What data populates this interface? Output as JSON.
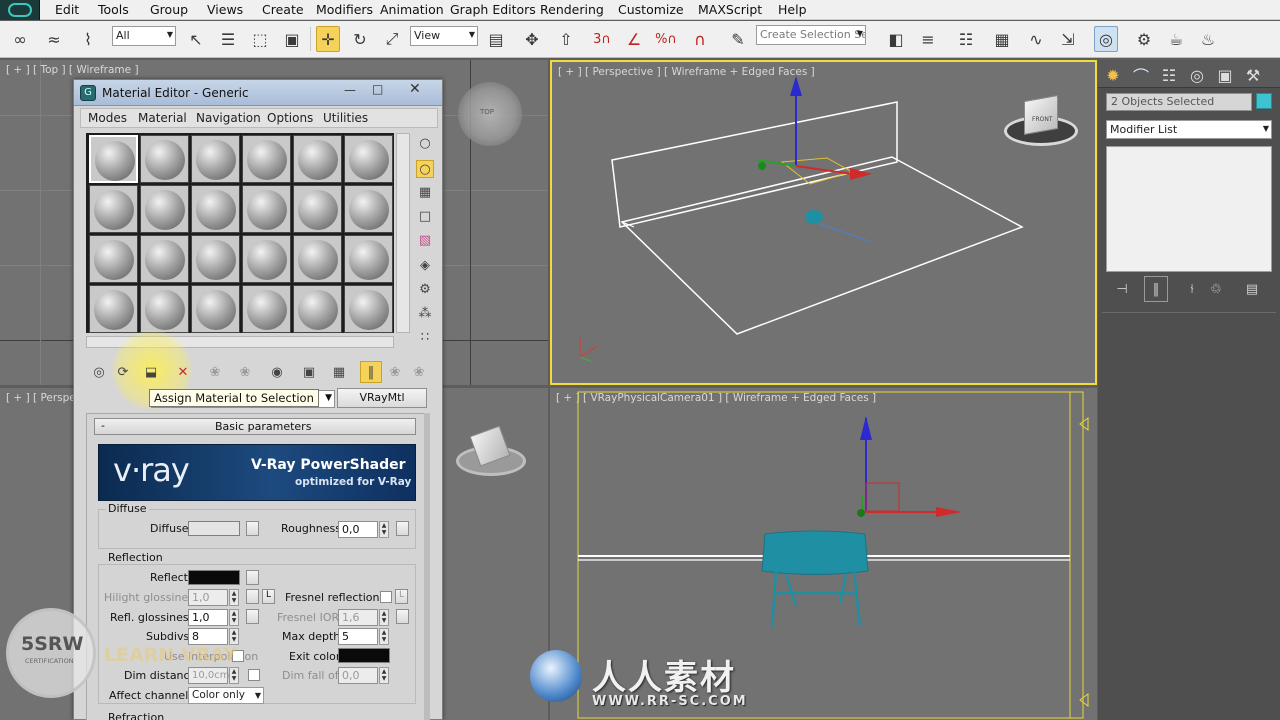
{
  "menu": [
    "Edit",
    "Tools",
    "Group",
    "Views",
    "Create",
    "Modifiers",
    "Animation",
    "Graph Editors",
    "Rendering",
    "Customize",
    "MAXScript",
    "Help"
  ],
  "toolbar": {
    "filter_value": "All",
    "refcoord_value": "View",
    "selection_set_placeholder": "Create Selection Se",
    "snap_labels": [
      "3",
      "%"
    ]
  },
  "viewports": {
    "top_label": "[ + ] [ Top ] [ Wireframe ]",
    "perspective_label": "[ + ] [ Perspective ] [ Wireframe + Edged Faces ]",
    "left_bottom_label": "[ + ] [ Perspec",
    "camera_label": "[ + ] [ VRayPhysicalCamera01 ] [ Wireframe + Edged Faces ]",
    "viewcube_top": "TOP",
    "viewcube_front": "FRONT"
  },
  "command_panel": {
    "selection_info": "2 Objects Selected",
    "modifier_list": "Modifier List"
  },
  "material_editor": {
    "title": "Material Editor - Generic",
    "menus": [
      "Modes",
      "Material",
      "Navigation",
      "Options",
      "Utilities"
    ],
    "tooltip": "Assign Material to Selection",
    "material_type": "VRayMtl",
    "rollout_title": "Basic parameters",
    "rollout_toggle": "-",
    "banner_brand": "v·ray",
    "banner_title": "V-Ray PowerShader",
    "banner_subtitle": "optimized for V-Ray",
    "diffuse": {
      "group": "Diffuse",
      "diffuse_label": "Diffuse",
      "roughness_label": "Roughness",
      "roughness_value": "0,0"
    },
    "reflection": {
      "group": "Reflection",
      "reflect_label": "Reflect",
      "hilight_label": "Hilight glossiness",
      "hilight_value": "1,0",
      "lock_label": "L",
      "fresnel_label": "Fresnel reflections",
      "fresnel_lock": "L",
      "refl_gloss_label": "Refl. glossiness",
      "refl_gloss_value": "1,0",
      "fresnel_ior_label": "Fresnel IOR",
      "fresnel_ior_value": "1,6",
      "subdivs_label": "Subdivs",
      "subdivs_value": "8",
      "max_depth_label": "Max depth",
      "max_depth_value": "5",
      "use_interp_label": "Use interpolation",
      "exit_color_label": "Exit color",
      "dim_distance_label": "Dim distance",
      "dim_distance_value": "10,0cm",
      "dim_falloff_label": "Dim fall off",
      "dim_falloff_value": "0,0",
      "affect_channels_label": "Affect channels",
      "affect_channels_value": "Color only"
    },
    "refraction": {
      "group": "Refraction"
    }
  },
  "watermarks": {
    "left_logo": "5SRW",
    "left_sub": "CERTIFICATION",
    "learn": "LEARN VRAY",
    "cn_main": "人人素材",
    "cn_url": "WWW.RR-SC.COM"
  },
  "colors": {
    "viewport_bg": "#727272",
    "active_border": "#f0dd3c",
    "selection_yellow": "#f5d35a",
    "object_teal": "#1f8fa3"
  }
}
